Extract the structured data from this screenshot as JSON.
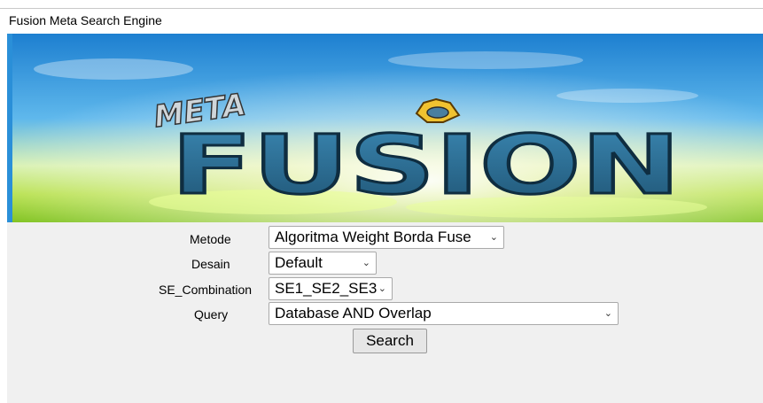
{
  "page": {
    "title": "Fusion Meta Search Engine"
  },
  "banner": {
    "logo_small": "META",
    "logo_big": "FUSION"
  },
  "form": {
    "metode": {
      "label": "Metode",
      "value": "Algoritma Weight Borda Fuse"
    },
    "desain": {
      "label": "Desain",
      "value": "Default"
    },
    "se_combination": {
      "label": "SE_Combination",
      "value": "SE1_SE2_SE3"
    },
    "query": {
      "label": "Query",
      "value": "Database AND Overlap"
    },
    "search_label": "Search"
  },
  "icons": {
    "dropdown": "chevron-down-icon",
    "emblem": "helmet-emblem-icon"
  },
  "colors": {
    "sky": "#2a8fd8",
    "grass": "#b6e04a",
    "logo_fill": "#2f6f94",
    "background": "#f0f0f0"
  }
}
